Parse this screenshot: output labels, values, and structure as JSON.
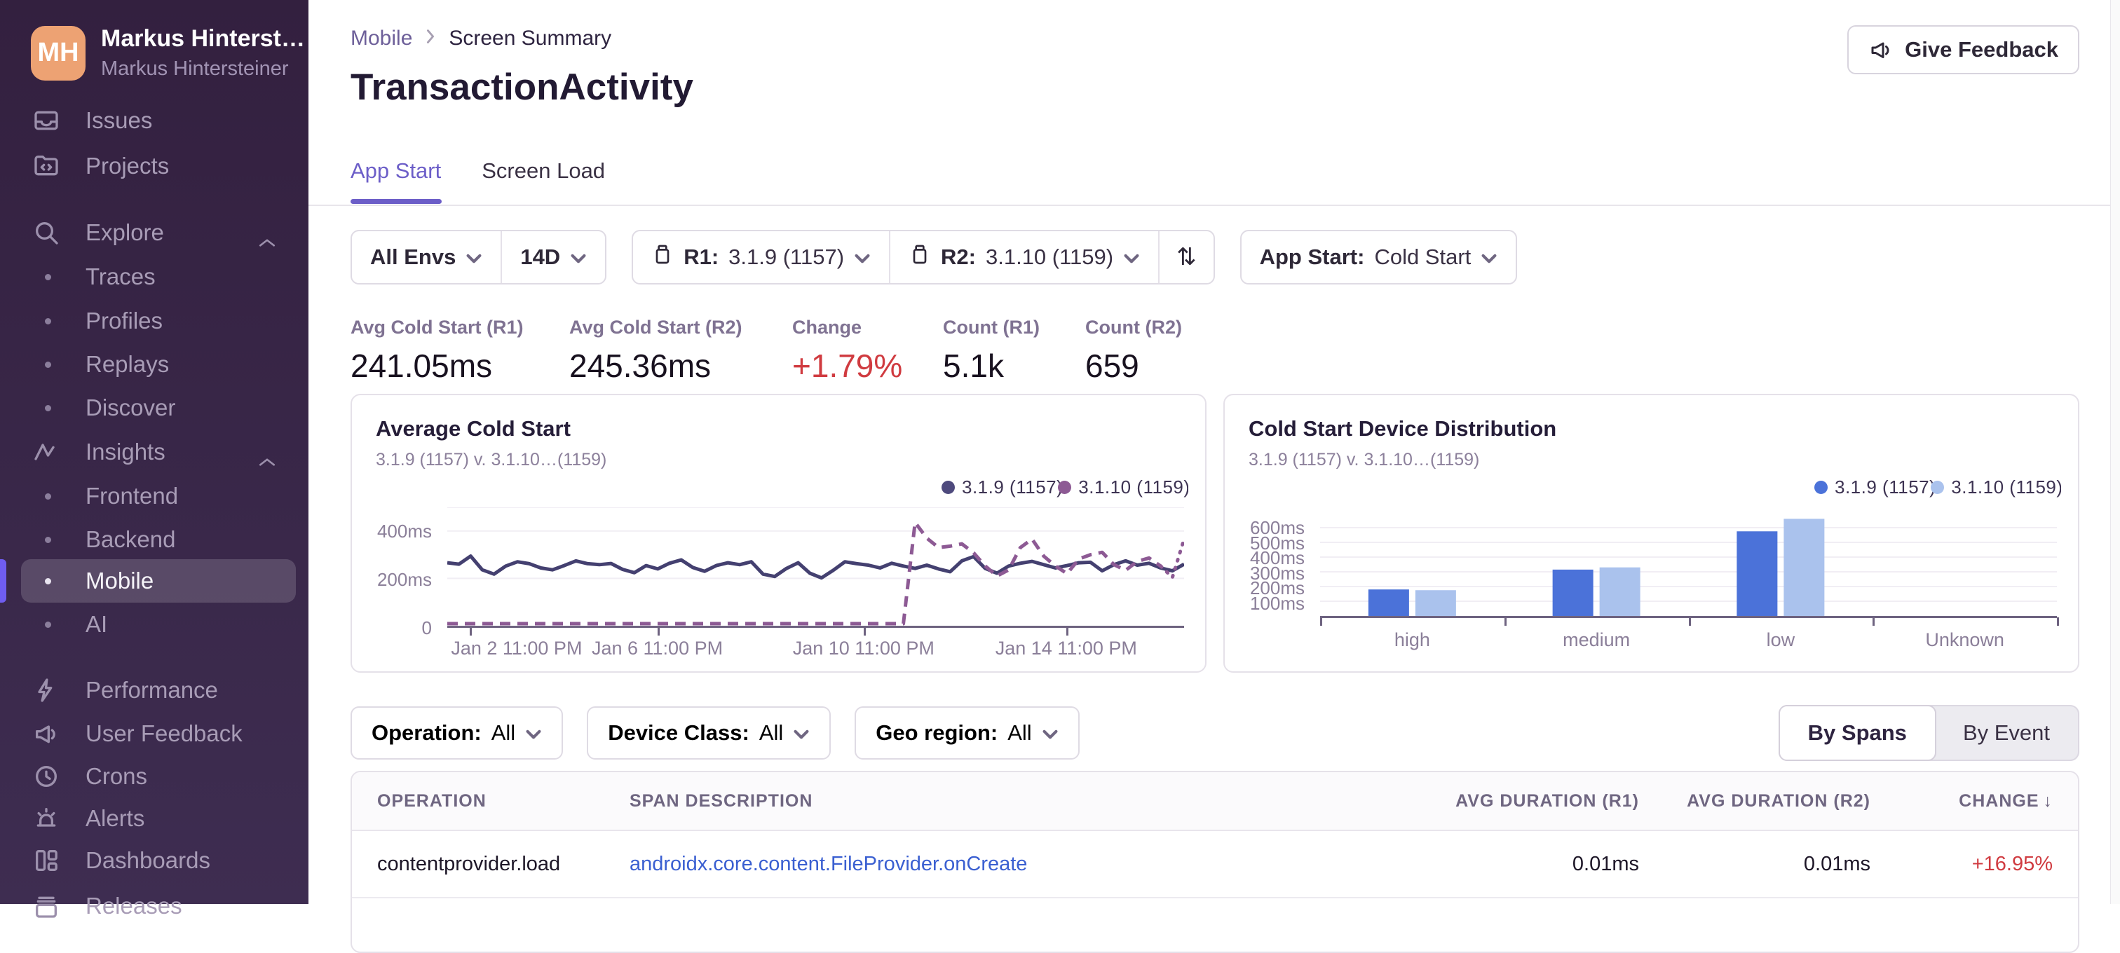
{
  "colors": {
    "accent_purple": "#6c5ec8",
    "sidebar_accent": "#6f5df0",
    "negative_red": "#d03b40",
    "link_blue": "#3a5fd1",
    "avatar_bg": "#eda273"
  },
  "sidebar": {
    "user": {
      "initials": "MH",
      "name": "Markus Hinterst…",
      "subtitle": "Markus Hintersteiner"
    },
    "items": {
      "issues": "Issues",
      "projects": "Projects",
      "explore": "Explore",
      "traces": "Traces",
      "profiles": "Profiles",
      "replays": "Replays",
      "discover": "Discover",
      "insights": "Insights",
      "frontend": "Frontend",
      "backend": "Backend",
      "mobile": "Mobile",
      "ai": "AI",
      "performance": "Performance",
      "user_feedback": "User Feedback",
      "crons": "Crons",
      "alerts": "Alerts",
      "dashboards": "Dashboards",
      "releases": "Releases"
    },
    "selected": "Mobile"
  },
  "header": {
    "breadcrumb": {
      "parent": "Mobile",
      "current": "Screen Summary"
    },
    "title": "TransactionActivity",
    "feedback_button": "Give Feedback",
    "tabs": {
      "app_start": "App Start",
      "screen_load": "Screen Load",
      "active": "App Start"
    }
  },
  "filters": {
    "env": "All Envs",
    "date_range": "14D",
    "r1_label": "R1:",
    "r1_value": "3.1.9 (1157)",
    "r2_label": "R2:",
    "r2_value": "3.1.10 (1159)",
    "swap_glyph": "⇅",
    "app_start_label": "App Start:",
    "app_start_value": "Cold Start"
  },
  "metrics": [
    {
      "label": "Avg Cold Start (R1)",
      "value": "241.05ms"
    },
    {
      "label": "Avg Cold Start (R2)",
      "value": "245.36ms"
    },
    {
      "label": "Change",
      "value": "+1.79%",
      "negative": true
    },
    {
      "label": "Count (R1)",
      "value": "5.1k"
    },
    {
      "label": "Count (R2)",
      "value": "659"
    }
  ],
  "chart_data": [
    {
      "type": "line",
      "title": "Average Cold Start",
      "subtitle": "3.1.9 (1157) v. 3.1.10…(1159)",
      "legend": [
        {
          "label": "3.1.9 (1157)",
          "color": "#4e4a7d"
        },
        {
          "label": "3.1.10 (1159)",
          "color": "#8d5a94"
        }
      ],
      "ylim": [
        0,
        500
      ],
      "y_unit": "ms",
      "y_grid": [
        500,
        400,
        200
      ],
      "y_ticks": [
        {
          "label": "400ms",
          "v": 400
        },
        {
          "label": "200ms",
          "v": 200
        },
        {
          "label": "0",
          "v": 0
        }
      ],
      "x_ticks": [
        {
          "label": "Jan 2 11:00 PM",
          "f": 0.03
        },
        {
          "label": "Jan 6 11:00 PM",
          "f": 0.285
        },
        {
          "label": "Jan 10 11:00 PM",
          "f": 0.565
        },
        {
          "label": "Jan 14 11:00 PM",
          "f": 0.84
        }
      ],
      "series": [
        {
          "name": "3.1.9 (1157)",
          "style": "solid",
          "color": "#444070",
          "values": [
            266,
            260,
            294,
            236,
            218,
            252,
            270,
            262,
            244,
            236,
            254,
            274,
            262,
            258,
            263,
            238,
            224,
            254,
            240,
            264,
            278,
            246,
            230,
            254,
            266,
            258,
            270,
            218,
            208,
            242,
            266,
            222,
            202,
            234,
            270,
            262,
            256,
            244,
            264,
            252,
            242,
            256,
            240,
            228,
            274,
            292,
            242,
            222,
            252,
            264,
            272,
            258,
            244,
            254,
            266,
            268,
            232,
            258,
            274,
            256,
            264,
            244,
            232,
            260
          ]
        },
        {
          "name": "3.1.10 (1159)",
          "style": "dashed",
          "color": "#8d5a94",
          "dotted_tail_points": 2,
          "values": [
            0,
            0,
            0,
            0,
            0,
            0,
            0,
            0,
            0,
            0,
            0,
            0,
            0,
            0,
            0,
            0,
            0,
            0,
            0,
            0,
            0,
            0,
            0,
            0,
            0,
            0,
            0,
            0,
            0,
            0,
            0,
            0,
            0,
            0,
            0,
            0,
            0,
            0,
            0,
            0,
            436,
            370,
            330,
            336,
            346,
            308,
            252,
            210,
            236,
            330,
            366,
            294,
            252,
            220,
            282,
            300,
            310,
            258,
            234,
            272,
            286,
            252,
            204,
            366
          ]
        }
      ]
    },
    {
      "type": "bar",
      "title": "Cold Start Device Distribution",
      "subtitle": "3.1.9 (1157) v. 3.1.10…(1159)",
      "legend": [
        {
          "label": "3.1.9 (1157)",
          "color": "#4b72d9"
        },
        {
          "label": "3.1.10 (1159)",
          "color": "#aac2ed"
        }
      ],
      "categories": [
        "high",
        "medium",
        "low",
        "Unknown"
      ],
      "ylim": [
        0,
        700
      ],
      "y_unit": "ms",
      "y_grid": [
        600,
        500,
        400,
        300,
        200,
        100
      ],
      "y_ticks": [
        {
          "label": "600ms",
          "v": 600
        },
        {
          "label": "500ms",
          "v": 500
        },
        {
          "label": "400ms",
          "v": 400
        },
        {
          "label": "300ms",
          "v": 300
        },
        {
          "label": "200ms",
          "v": 200
        },
        {
          "label": "100ms",
          "v": 100
        }
      ],
      "series": [
        {
          "name": "3.1.9 (1157)",
          "color": "#4b72d9",
          "values": [
            180,
            315,
            575,
            0
          ]
        },
        {
          "name": "3.1.10 (1159)",
          "color": "#aac2ed",
          "values": [
            175,
            330,
            660,
            0
          ]
        }
      ]
    }
  ],
  "span_filters": {
    "operation_label": "Operation:",
    "operation_value": "All",
    "device_class_label": "Device Class:",
    "device_class_value": "All",
    "geo_label": "Geo region:",
    "geo_value": "All",
    "by_spans": "By Spans",
    "by_event": "By Event",
    "active": "By Spans"
  },
  "table": {
    "columns": [
      "OPERATION",
      "SPAN DESCRIPTION",
      "AVG DURATION (R1)",
      "AVG DURATION (R2)",
      "CHANGE"
    ],
    "sort_column": "CHANGE",
    "sort_glyph": "↓",
    "rows": [
      {
        "operation": "contentprovider.load",
        "span_description": "androidx.core.content.FileProvider.onCreate",
        "avg_r1": "0.01ms",
        "avg_r2": "0.01ms",
        "change": "+16.95%"
      }
    ]
  }
}
